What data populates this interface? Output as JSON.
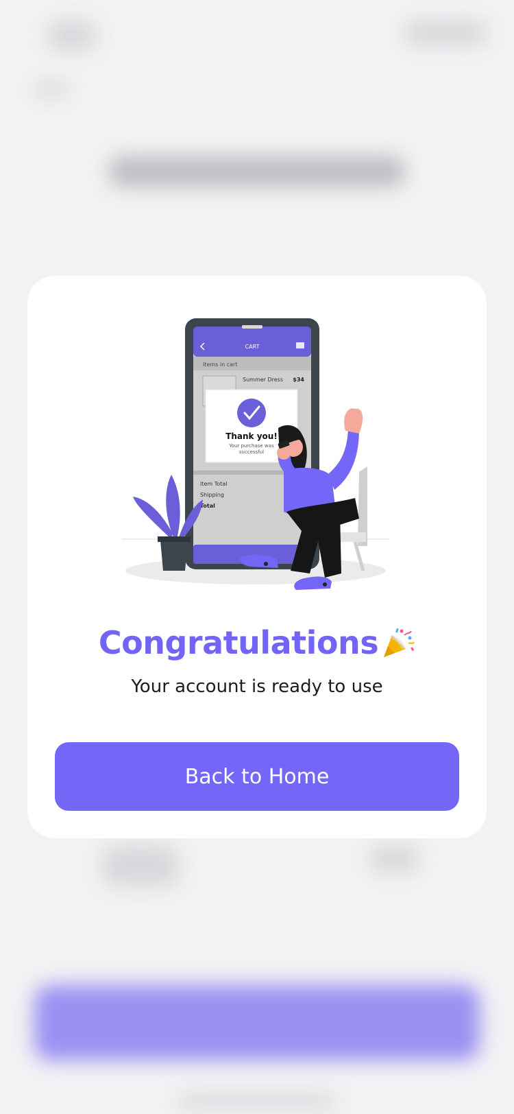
{
  "modal": {
    "title": "Congratulations",
    "title_emoji_icon": "party-popper-icon",
    "subtitle": "Your account is ready to use",
    "button_label": "Back to Home"
  },
  "illustration": {
    "phone_header": "CART",
    "items_label": "Items in cart",
    "product_name": "Summer Dress",
    "product_price": "$34",
    "thank_you": "Thank you!",
    "purchase_line1": "Your purchase was",
    "purchase_line2": "successful",
    "item_total": "Item Total",
    "shipping": "Shipping",
    "total": "Total"
  },
  "colors": {
    "accent": "#7466f7",
    "title": "#7264f6",
    "background": "#f2f2f4",
    "card": "#ffffff"
  }
}
